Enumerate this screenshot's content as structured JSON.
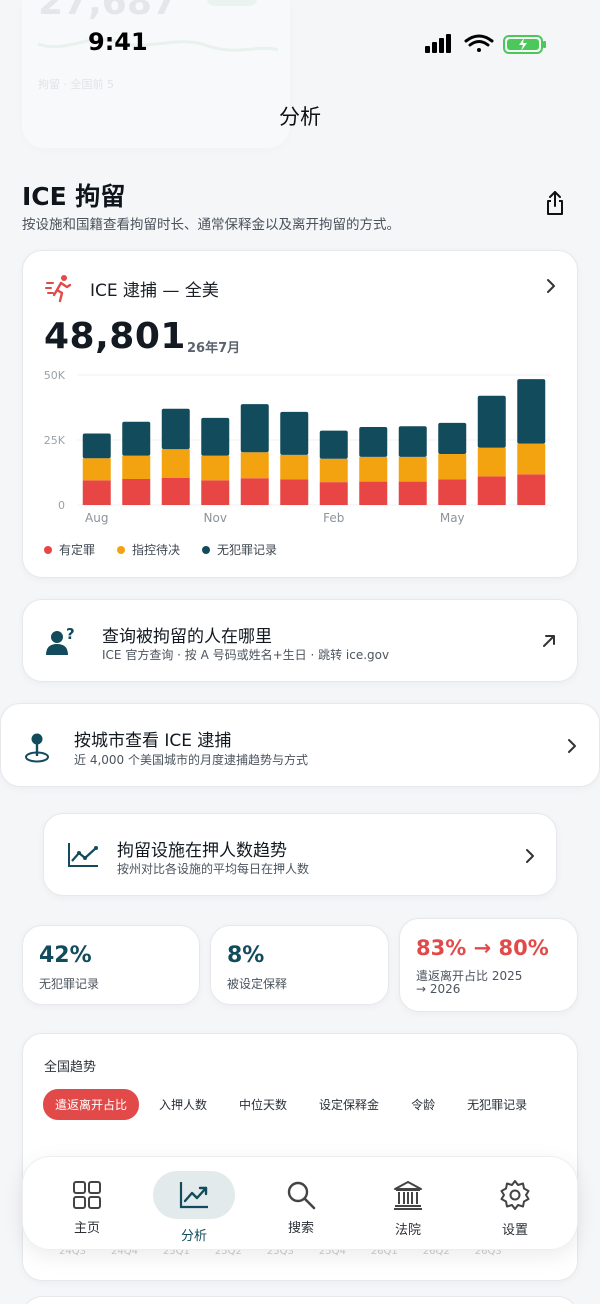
{
  "status_bar": {
    "time": "9:41"
  },
  "background_ghost": {
    "number": "27,687",
    "subtext": "拘留 · 全国前 5"
  },
  "nav": {
    "title": "分析"
  },
  "header": {
    "title": "ICE 拘留",
    "subtitle": "按设施和国籍查看拘留时长、通常保释金以及离开拘留的方式。"
  },
  "arrest_card": {
    "title": "ICE 逮捕 — 全美",
    "value": "48,801",
    "date": "26年7月",
    "legend": [
      "有定罪",
      "指控待决",
      "无犯罪记录"
    ]
  },
  "chart_data": {
    "type": "bar",
    "stacked": true,
    "categories": [
      "Aug",
      "Sep",
      "Oct",
      "Nov",
      "Dec",
      "Jan",
      "Feb",
      "Mar",
      "Apr",
      "May",
      "Jun",
      "Jul"
    ],
    "x_tick_labels": [
      "Aug",
      "Nov",
      "Feb",
      "May"
    ],
    "ylim": [
      0,
      50000
    ],
    "y_tick_labels": [
      "0",
      "25K",
      "50K"
    ],
    "series": [
      {
        "name": "有定罪",
        "color": "#e84545",
        "values": [
          9500,
          10000,
          10500,
          9500,
          10300,
          9800,
          8800,
          9000,
          9000,
          9800,
          11000,
          11800
        ]
      },
      {
        "name": "指控待决",
        "color": "#f4a310",
        "values": [
          8500,
          9000,
          11000,
          9500,
          10000,
          9500,
          9000,
          9500,
          9500,
          9800,
          11000,
          11800
        ]
      },
      {
        "name": "无犯罪记录",
        "color": "#124c5c",
        "values": [
          9500,
          13000,
          15500,
          14500,
          18500,
          16500,
          10800,
          11500,
          11800,
          12000,
          20000,
          24800
        ]
      }
    ],
    "grid": true
  },
  "lookup_card": {
    "title": "查询被拘留的人在哪里",
    "subtitle": "ICE 官方查询 · 按 A 号码或姓名+生日 · 跳转 ice.gov"
  },
  "city_card": {
    "title": "按城市查看 ICE 逮捕",
    "subtitle": "近 4,000 个美国城市的月度逮捕趋势与方式"
  },
  "facility_card": {
    "title": "拘留设施在押人数趋势",
    "subtitle": "按州对比各设施的平均每日在押人数"
  },
  "stats": [
    {
      "value": "42%",
      "label": "无犯罪记录",
      "color": "#124c5c"
    },
    {
      "value": "8%",
      "label": "被设定保释",
      "color": "#124c5c"
    },
    {
      "value": "83% → 80%",
      "label_line1": "遣返离开占比 2025",
      "label_line2": "→ 2026",
      "color": "#e24a4a"
    }
  ],
  "trend_card": {
    "heading": "全国趋势",
    "chips": [
      "遣返离开占比",
      "入押人数",
      "中位天数",
      "设定保释金",
      "令龄",
      "无犯罪记录"
    ],
    "active_chip": 0,
    "ghost_axis": [
      "24Q3",
      "24Q4",
      "25Q1",
      "25Q2",
      "25Q3",
      "25Q4",
      "26Q1",
      "26Q2",
      "26Q3"
    ]
  },
  "tabbar": {
    "tabs": [
      {
        "label": "主页",
        "icon": "grid-icon"
      },
      {
        "label": "分析",
        "icon": "trend-chart-icon"
      },
      {
        "label": "搜索",
        "icon": "search-icon"
      },
      {
        "label": "法院",
        "icon": "courthouse-icon"
      },
      {
        "label": "设置",
        "icon": "gear-icon"
      }
    ],
    "active": 1
  }
}
